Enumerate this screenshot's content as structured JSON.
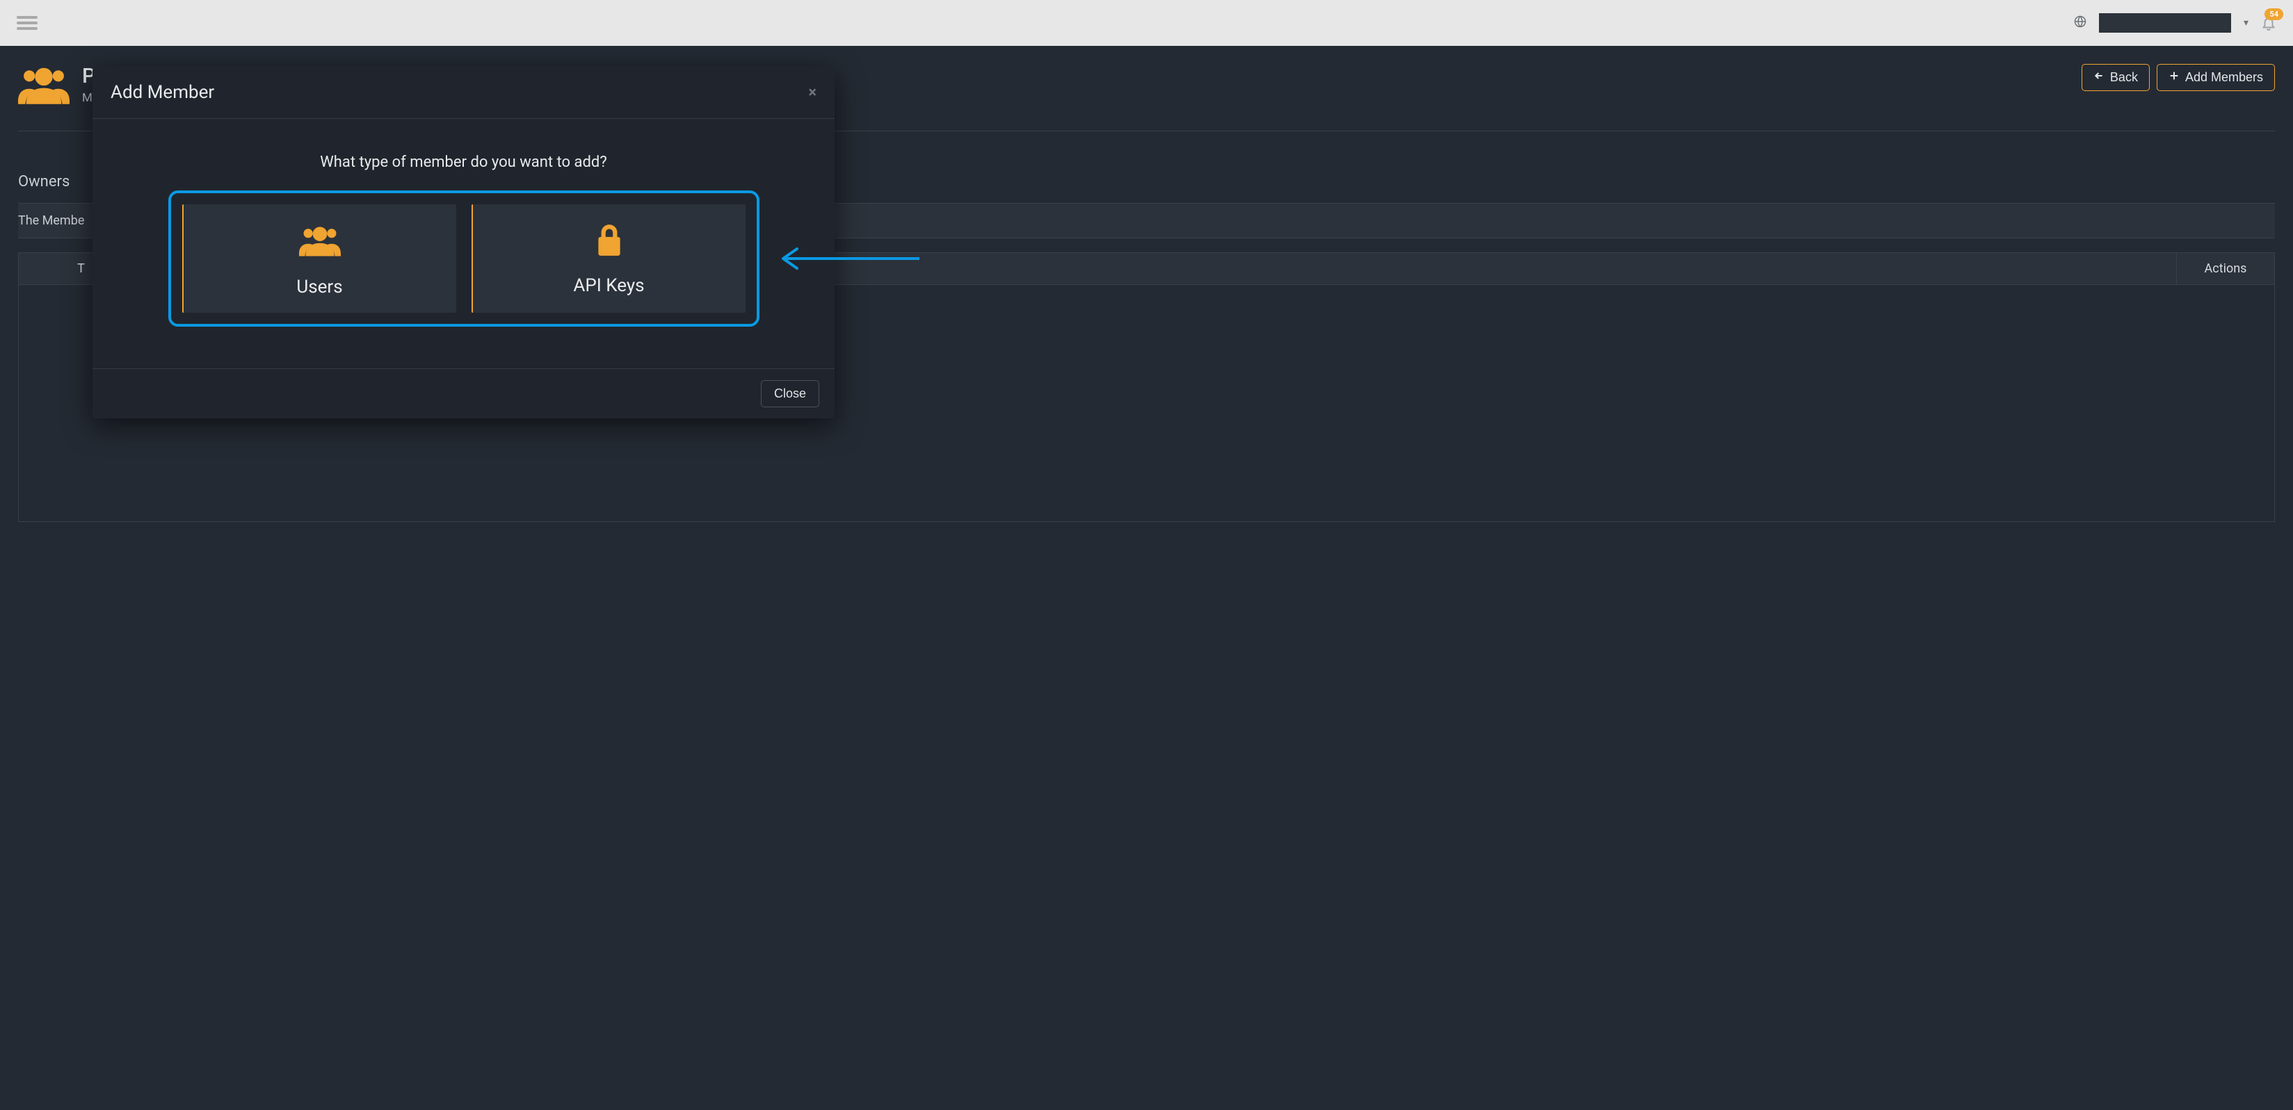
{
  "topbar": {
    "notifications_count": "54"
  },
  "page": {
    "title_fragment": "P",
    "subtitle_fragment": "M",
    "back_label": "Back",
    "add_members_label": "Add Members",
    "tab_owners": "Owners",
    "subtext_fragment": "The Membe",
    "col_t": "T",
    "col_actions": "Actions"
  },
  "modal": {
    "title": "Add Member",
    "question": "What type of member do you want to add?",
    "option_users": "Users",
    "option_api_keys": "API Keys",
    "close_label": "Close"
  }
}
